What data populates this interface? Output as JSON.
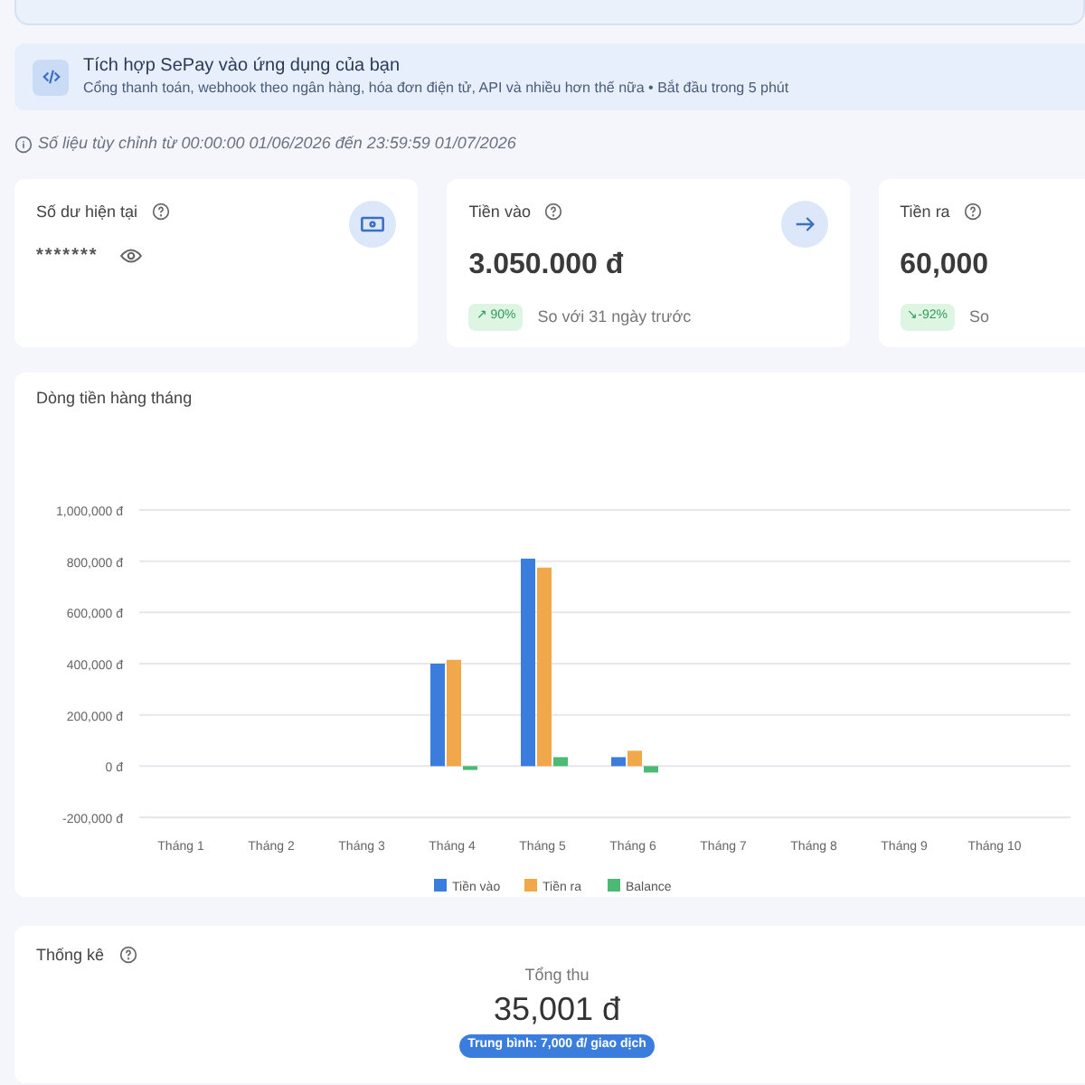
{
  "integration_banner": {
    "title": "Tích hợp SePay vào ứng dụng của bạn",
    "subtitle": "Cổng thanh toán, webhook theo ngân hàng, hóa đơn điện tử, API và nhiều hơn thế nữa • Bắt đầu trong 5 phút"
  },
  "date_range_note": "Số liệu tùy chỉnh từ 00:00:00 01/06/2026 đến 23:59:59 01/07/2026",
  "stat_cards": [
    {
      "kind": "balance",
      "title": "Số dư hiện tại",
      "value": "*******"
    },
    {
      "kind": "flow",
      "title": "Tiền vào",
      "value": "3.050.000 đ",
      "change": "↗ 90%",
      "comparison": "So với 31 ngày trước"
    },
    {
      "kind": "flow",
      "title": "Tiền ra",
      "value": "60,000",
      "change": "↘-92%",
      "comparison": "So"
    }
  ],
  "monthly_cashflow": {
    "title": "Dòng tiền hàng tháng",
    "chart_data": {
      "type": "bar",
      "categories": [
        "Tháng 1",
        "Tháng 2",
        "Tháng 3",
        "Tháng 4",
        "Tháng 5",
        "Tháng 6",
        "Tháng 7",
        "Tháng 8",
        "Tháng 9",
        "Tháng 10"
      ],
      "series": [
        {
          "name": "Tiền vào",
          "color": "#3b7ddd",
          "values": [
            0,
            0,
            0,
            400000,
            810000,
            35000,
            0,
            0,
            0,
            0
          ]
        },
        {
          "name": "Tiền ra",
          "color": "#f0a84b",
          "values": [
            0,
            0,
            0,
            415000,
            775000,
            60000,
            0,
            0,
            0,
            0
          ]
        },
        {
          "name": "Balance",
          "color": "#4cba74",
          "values": [
            0,
            0,
            0,
            -15000,
            35000,
            -25000,
            0,
            0,
            0,
            0
          ]
        }
      ],
      "grid": true,
      "legend": true,
      "ylim": [
        -200000,
        1000000
      ],
      "yticks": [
        {
          "value": -200000,
          "label": "-200,000 đ"
        },
        {
          "value": 0,
          "label": "0 đ"
        },
        {
          "value": 200000,
          "label": "200,000 đ"
        },
        {
          "value": 400000,
          "label": "400,000 đ"
        },
        {
          "value": 600000,
          "label": "600,000 đ"
        },
        {
          "value": 800000,
          "label": "800,000 đ"
        },
        {
          "value": 1000000,
          "label": "1,000,000 đ"
        }
      ]
    }
  },
  "statistics": {
    "title": "Thống kê",
    "total_label": "Tổng thu",
    "total_value": "35,001 đ",
    "average_badge": "Trung bình: 7,000 đ/ giao dịch"
  }
}
